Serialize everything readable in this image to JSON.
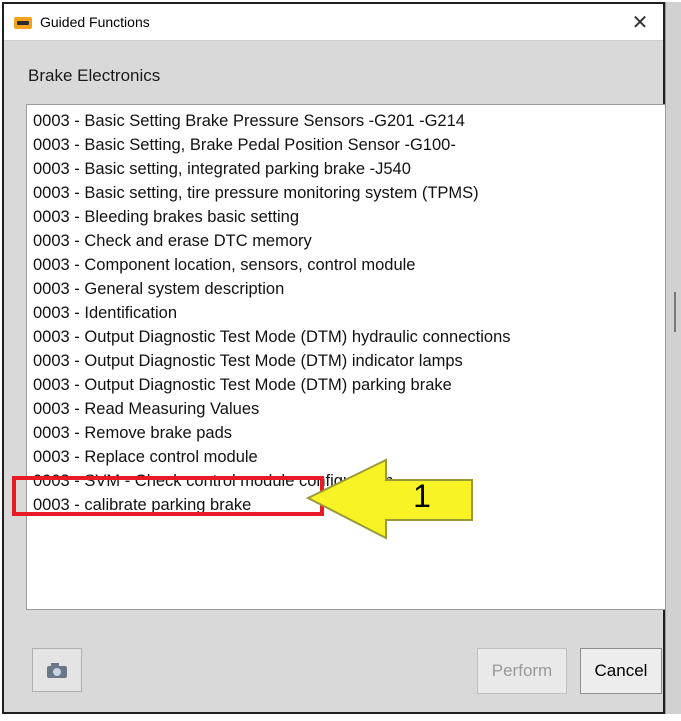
{
  "window": {
    "title": "Guided Functions",
    "close_glyph": "✕"
  },
  "group": {
    "label": "Brake Electronics"
  },
  "list_items": [
    "0003 - Basic Setting Brake Pressure Sensors -G201 -G214",
    "0003 - Basic Setting, Brake Pedal Position Sensor -G100-",
    "0003 - Basic setting, integrated parking brake -J540",
    "0003 - Basic setting, tire pressure monitoring system (TPMS)",
    "0003 - Bleeding brakes basic setting",
    "0003 - Check and erase DTC memory",
    "0003 - Component location, sensors, control module",
    "0003 - General system description",
    "0003 - Identification",
    "0003 - Output Diagnostic Test Mode (DTM) hydraulic connections",
    "0003 - Output Diagnostic Test Mode (DTM) indicator lamps",
    "0003 - Output Diagnostic Test Mode (DTM) parking brake",
    "0003 - Read Measuring Values",
    "0003 - Remove brake pads",
    "0003 - Replace control module",
    "0003 - SVM - Check control module configuration",
    "0003  - calibrate parking brake"
  ],
  "buttons": {
    "camera_icon": "camera-icon",
    "perform": "Perform",
    "cancel": "Cancel"
  },
  "annotation": {
    "number": "1",
    "highlight_color": "#e61b23",
    "arrow_color": "#f7f324"
  }
}
